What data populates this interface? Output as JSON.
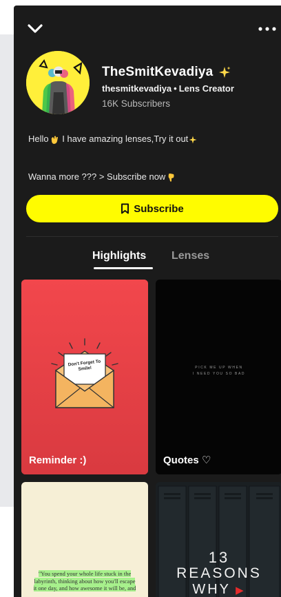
{
  "profile": {
    "name": "TheSmitKevadiya",
    "handle": "thesmitkevadiya",
    "role": "Lens Creator",
    "subscribers": "16K Subscribers",
    "bio_line1_a": "Hello",
    "bio_line1_b": "I have amazing lenses,Try it out",
    "bio_line2": "Wanna more ??? > Subscribe now"
  },
  "actions": {
    "subscribe_label": "Subscribe"
  },
  "tabs": [
    {
      "label": "Highlights",
      "selected": true
    },
    {
      "label": "Lenses",
      "selected": false
    }
  ],
  "highlights": [
    {
      "title": "Reminder :)",
      "note_text": "Don't Forget To Smile!"
    },
    {
      "title": "Quotes ♡",
      "quote_line1": "PICK ME UP WHEN",
      "quote_line2": "I NEED YOU SO BAD"
    },
    {
      "title": "",
      "book_text_a": "\"You spend your whole life stuck in the",
      "book_text_b": "labyrinth, thinking about how you'll escape",
      "book_text_c": "it one day, and how awesome it will be, and"
    },
    {
      "title": "",
      "line1": "13",
      "line2": "REASONS",
      "line3": "WHY"
    }
  ],
  "colors": {
    "accent_yellow": "#fffc00",
    "background": "#1b1b1b",
    "reminder_card": "#f0454a"
  }
}
